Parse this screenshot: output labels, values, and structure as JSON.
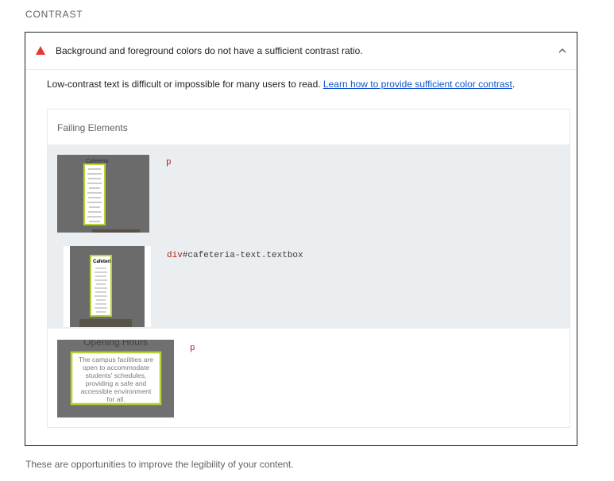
{
  "section": {
    "title": "CONTRAST"
  },
  "audit": {
    "title": "Background and foreground colors do not have a sufficient contrast ratio.",
    "description": "Low-contrast text is difficult or impossible for many users to read. ",
    "link_text": "Learn how to provide sufficient color contrast",
    "description_end": ".",
    "status_color": "#e53935"
  },
  "table": {
    "header": "Failing Elements",
    "rows": [
      {
        "tag": "p",
        "selector": "",
        "thumb_title": "Cafeteria"
      },
      {
        "tag": "div",
        "selector": "#cafeteria-text.textbox",
        "thumb_title": "Cafeteri"
      },
      {
        "tag": "p",
        "selector": "",
        "thumb_title": "Opening Hours",
        "thumb_lines": [
          "The campus facilities are",
          "open to accommodate",
          "students' schedules,",
          "providing a safe and",
          "accessible environment",
          "for all."
        ]
      }
    ]
  },
  "footer": {
    "note": "These are opportunities to improve the legibility of your content."
  }
}
